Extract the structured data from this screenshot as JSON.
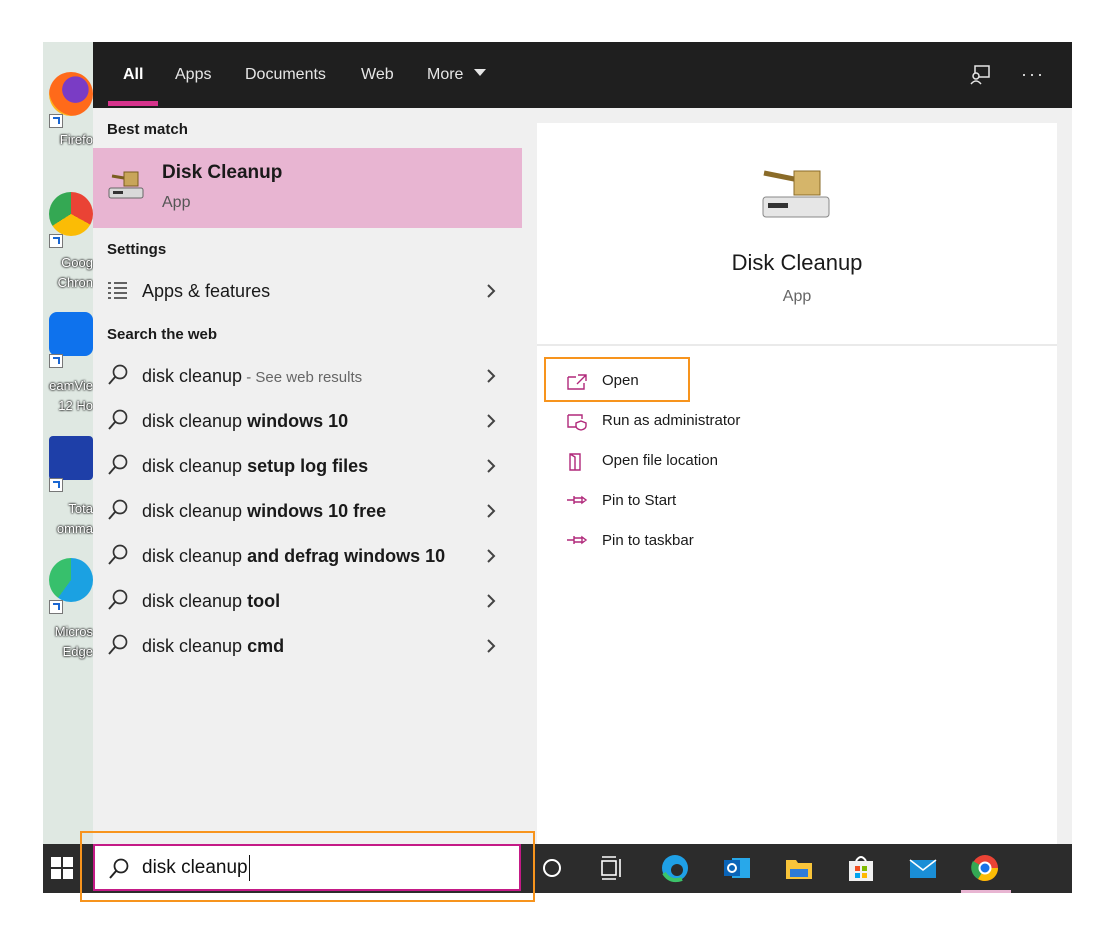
{
  "tabs": [
    {
      "label": "All",
      "active": true
    },
    {
      "label": "Apps"
    },
    {
      "label": "Documents"
    },
    {
      "label": "Web"
    },
    {
      "label": "More"
    }
  ],
  "desktop_icons": [
    {
      "label1": "Firefo",
      "label2": ""
    },
    {
      "label1": "Goog",
      "label2": "Chron"
    },
    {
      "label1": "eamVie",
      "label2": "12 Ho"
    },
    {
      "label1": "Tota",
      "label2": "omma"
    },
    {
      "label1": "Micros",
      "label2": "Edge"
    }
  ],
  "best_match": {
    "section_title": "Best match",
    "name": "Disk Cleanup",
    "type": "App"
  },
  "settings": {
    "section_title": "Settings",
    "items": [
      {
        "label": "Apps & features"
      }
    ]
  },
  "web": {
    "section_title": "Search the web",
    "items": [
      {
        "prefix": "disk cleanup",
        "bold": "",
        "suffix": " - See web results"
      },
      {
        "prefix": "disk cleanup ",
        "bold": "windows 10",
        "suffix": ""
      },
      {
        "prefix": "disk cleanup ",
        "bold": "setup log files",
        "suffix": ""
      },
      {
        "prefix": "disk cleanup ",
        "bold": "windows 10 free",
        "suffix": ""
      },
      {
        "prefix": "disk cleanup ",
        "bold": "and defrag windows 10",
        "suffix": ""
      },
      {
        "prefix": "disk cleanup ",
        "bold": "tool",
        "suffix": ""
      },
      {
        "prefix": "disk cleanup ",
        "bold": "cmd",
        "suffix": ""
      }
    ]
  },
  "preview": {
    "name": "Disk Cleanup",
    "type": "App",
    "actions": [
      {
        "label": "Open",
        "icon": "open-icon"
      },
      {
        "label": "Run as administrator",
        "icon": "shield-icon"
      },
      {
        "label": "Open file location",
        "icon": "file-location-icon"
      },
      {
        "label": "Pin to Start",
        "icon": "pin-icon"
      },
      {
        "label": "Pin to taskbar",
        "icon": "pin-icon"
      }
    ]
  },
  "search": {
    "value": "disk cleanup"
  },
  "colors": {
    "accent": "#c41a86",
    "highlight": "#e8b5d2",
    "annotation": "#f7941d",
    "topbar": "#1f1f1f",
    "taskbar": "#2c2c2c"
  }
}
